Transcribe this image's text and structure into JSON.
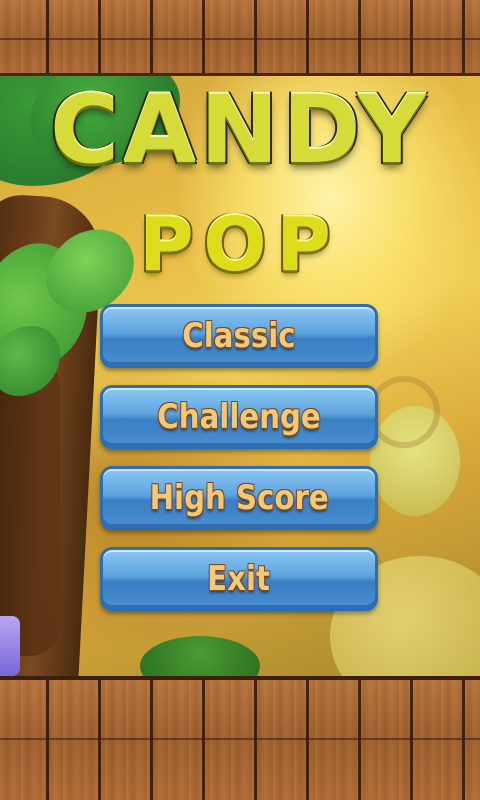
{
  "title": {
    "line1": "CANDY",
    "line2": "POP"
  },
  "menu": {
    "classic": "Classic",
    "challenge": "Challenge",
    "high_score": "High Score",
    "exit": "Exit"
  },
  "colors": {
    "button_fill": "#5ea3de",
    "button_border": "#2a6fb6",
    "button_text": "#f5c77a",
    "title_candy": "#d5dc3a",
    "title_pop": "#dedd1c",
    "wood": "#a0602f"
  }
}
